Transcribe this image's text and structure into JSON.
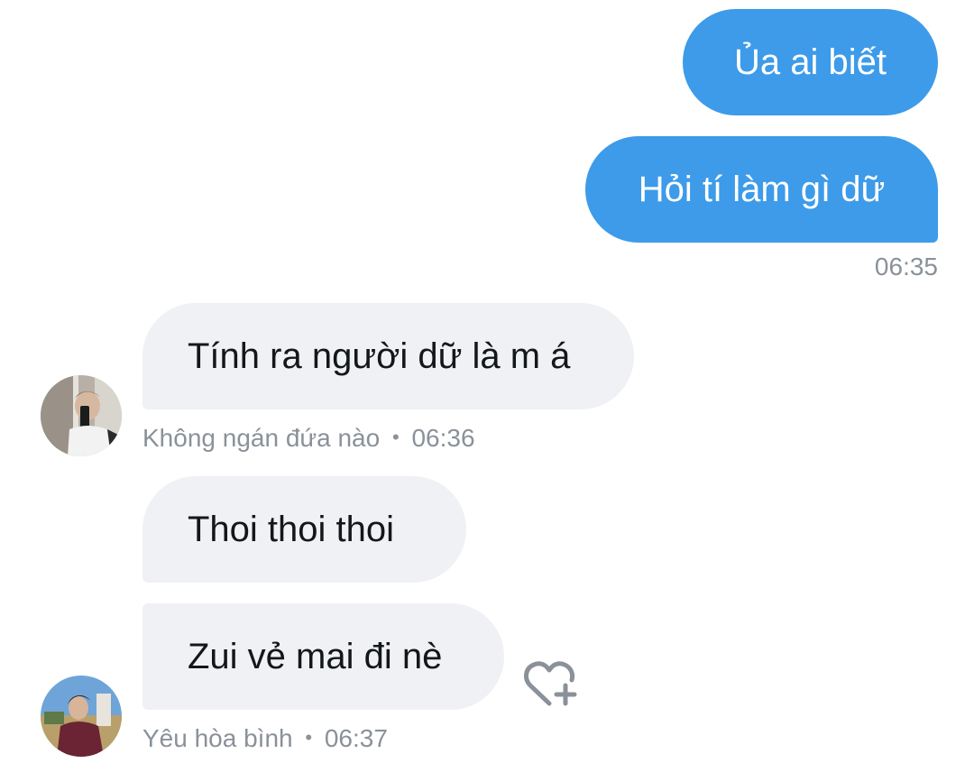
{
  "outgoing": [
    {
      "text": "Ủa ai biết"
    },
    {
      "text": "Hỏi tí làm gì dữ"
    }
  ],
  "outgoing_time": "06:35",
  "incoming": [
    {
      "text": "Tính ra người dữ là m á"
    },
    {
      "text": "Thoi thoi thoi"
    },
    {
      "text": "Zui vẻ mai đi nè"
    }
  ],
  "sender1": {
    "name": "Không ngán đứa nào",
    "separator": "•",
    "time": "06:36"
  },
  "sender2": {
    "name": "Yêu hòa bình",
    "separator": "•",
    "time": "06:37"
  },
  "icons": {
    "avatar1": "profile-photo",
    "avatar2": "profile-photo",
    "reaction": "heart-plus-icon"
  },
  "colors": {
    "outgoing_bubble": "#3d9be9",
    "incoming_bubble": "#f0f1f4",
    "meta_text": "#8a9199"
  }
}
